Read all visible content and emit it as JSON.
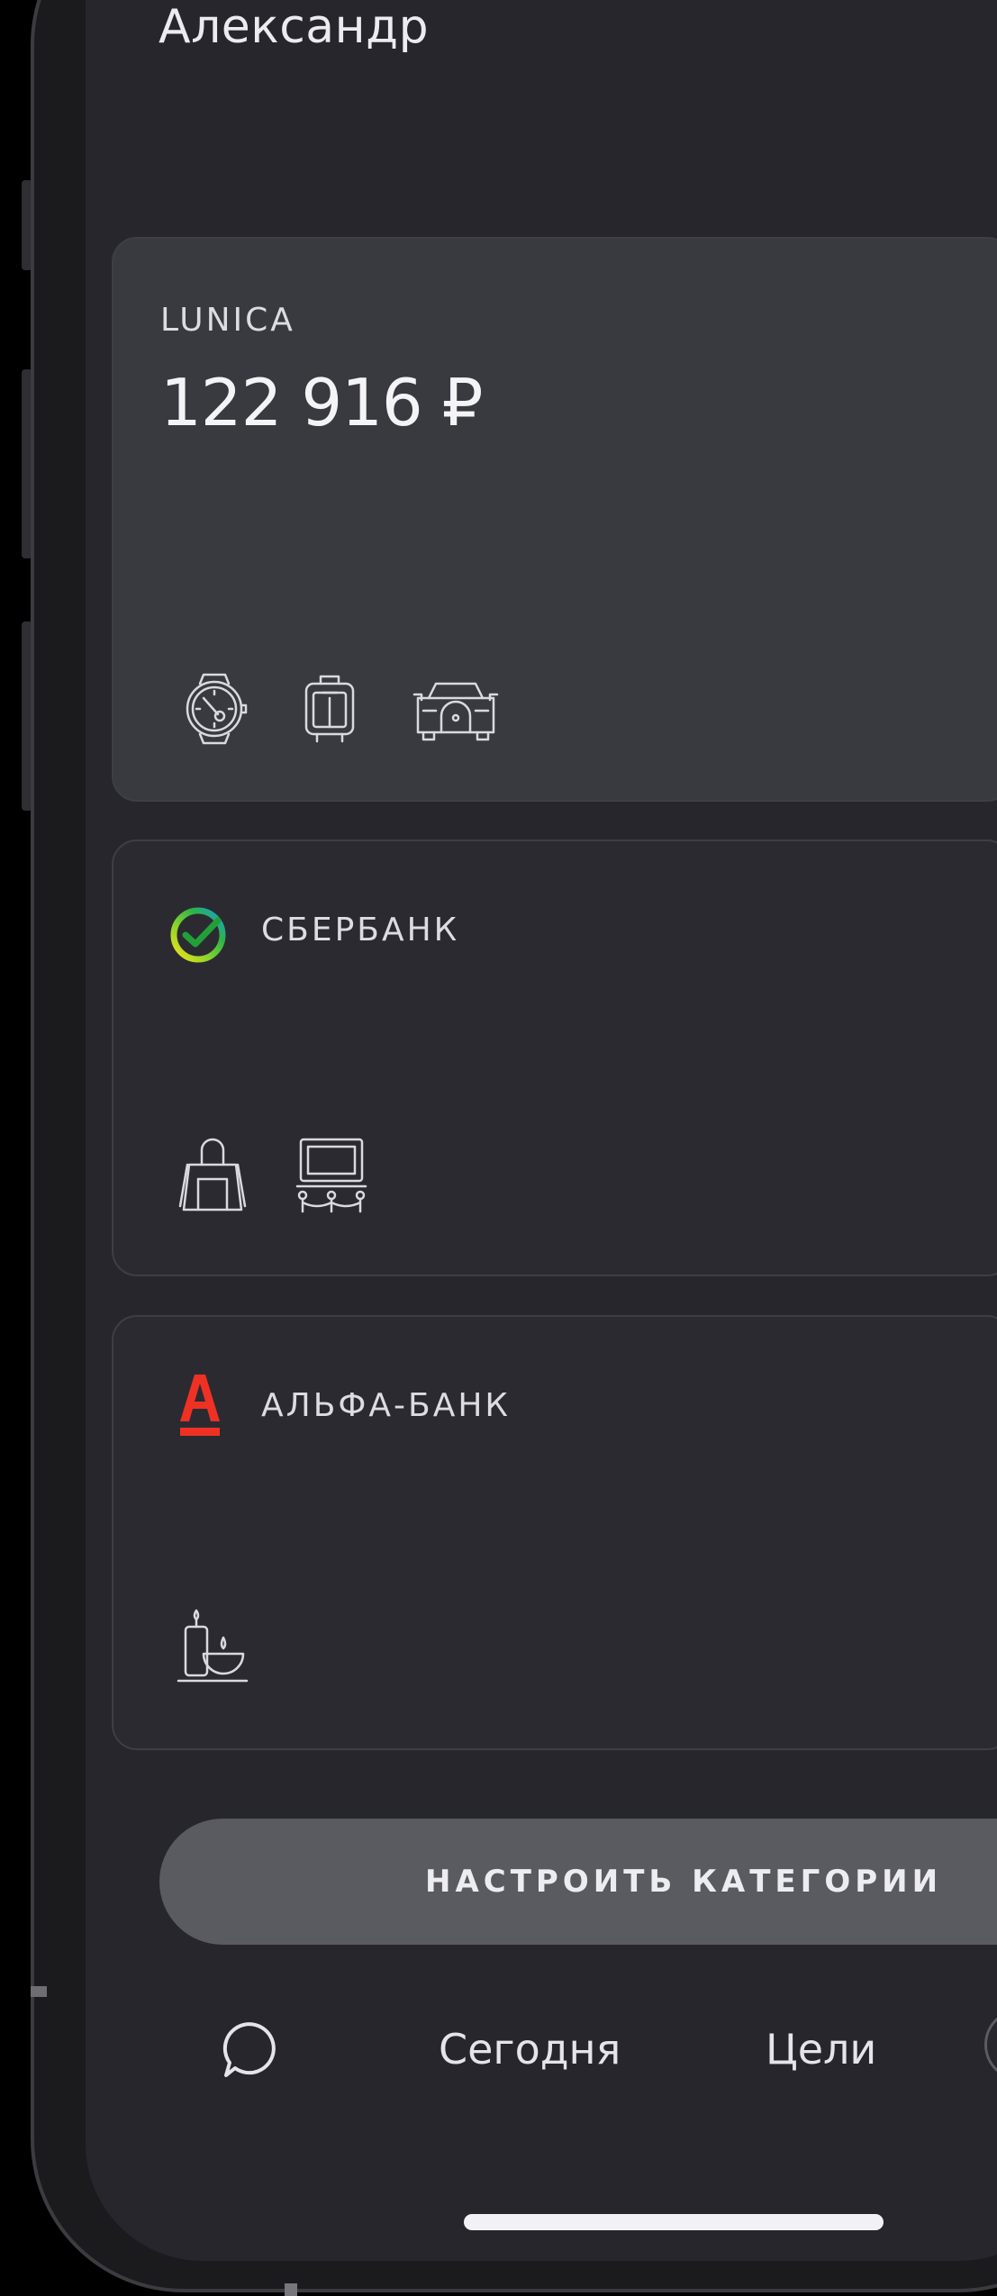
{
  "header": {
    "user_name": "Александр"
  },
  "accounts": [
    {
      "label": "LUNICA",
      "balance": "122 916 ₽",
      "category_icons": [
        "watch-icon",
        "suitcase-icon",
        "car-icon"
      ]
    },
    {
      "label": "СБЕРБАНК",
      "logo": "sberbank-logo-icon",
      "category_icons": [
        "shopping-bag-icon",
        "cinema-icon"
      ]
    },
    {
      "label": "АЛЬФА-БАНК",
      "logo": "alfa-bank-logo-icon",
      "category_icons": [
        "spa-candle-icon"
      ]
    }
  ],
  "actions": {
    "configure_categories": "НАСТРОИТЬ КАТЕГОРИИ"
  },
  "tabbar": {
    "chat_icon": "chat-bubble-icon",
    "today": "Сегодня",
    "goals": "Цели",
    "profile_icon": "profile-circle-icon"
  },
  "colors": {
    "background": "#27262d",
    "card_primary": "#393940",
    "card_secondary": "#2b2a31",
    "button": "#5a5a61",
    "alfa_red": "#ef3124",
    "sber_green": "#21a038"
  }
}
